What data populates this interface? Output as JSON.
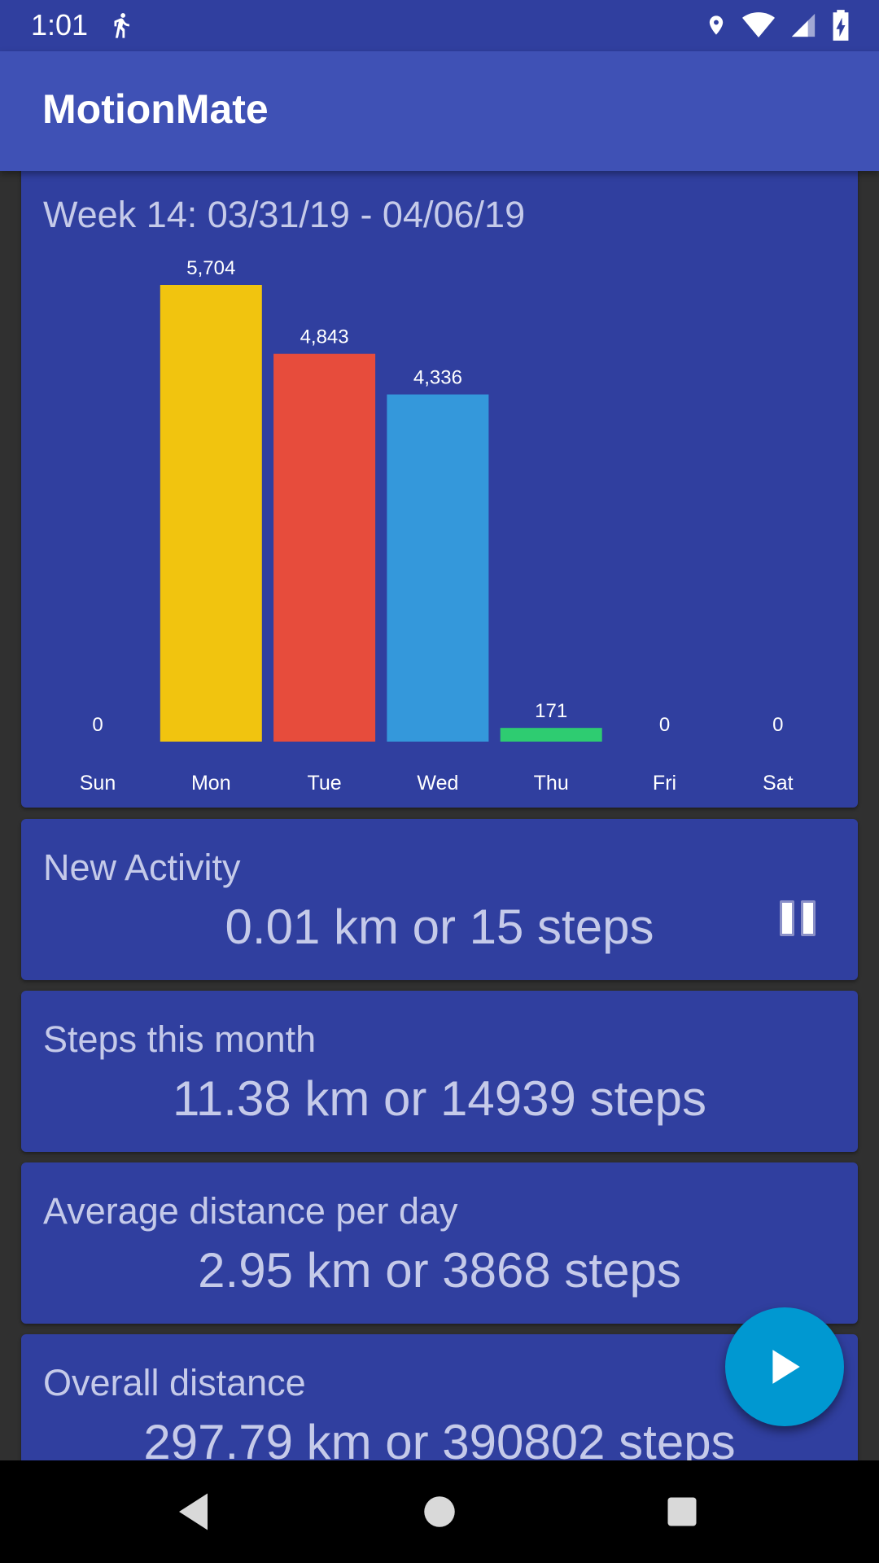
{
  "status_bar": {
    "time": "1:01"
  },
  "app_bar": {
    "title": "MotionMate"
  },
  "week_card": {
    "title": "Week 14: 03/31/19 - 04/06/19"
  },
  "chart_data": {
    "type": "bar",
    "categories": [
      "Sun",
      "Mon",
      "Tue",
      "Wed",
      "Thu",
      "Fri",
      "Sat"
    ],
    "values": [
      0,
      5704,
      4843,
      4336,
      171,
      0,
      0
    ],
    "value_labels": [
      "0",
      "5,704",
      "4,843",
      "4,336",
      "171",
      "0",
      "0"
    ],
    "colors": [
      "#F1C40F",
      "#F1C40F",
      "#E74C3C",
      "#3498DB",
      "#2ECC71",
      "#9B59B6",
      "#9B59B6"
    ],
    "ylim": [
      0,
      5704
    ]
  },
  "cards": {
    "new_activity": {
      "title": "New Activity",
      "value": "0.01 km or 15 steps"
    },
    "month": {
      "title": "Steps this month",
      "value": "11.38 km or 14939 steps"
    },
    "average": {
      "title": "Average distance per day",
      "value": "2.95 km or 3868 steps"
    },
    "overall": {
      "title": "Overall distance",
      "value": "297.79 km or 390802 steps"
    }
  },
  "colors": {
    "primary": "#3F51B5",
    "primary_dark": "#303F9F",
    "accent": "#0098D1",
    "text": "#C5CAE9"
  }
}
